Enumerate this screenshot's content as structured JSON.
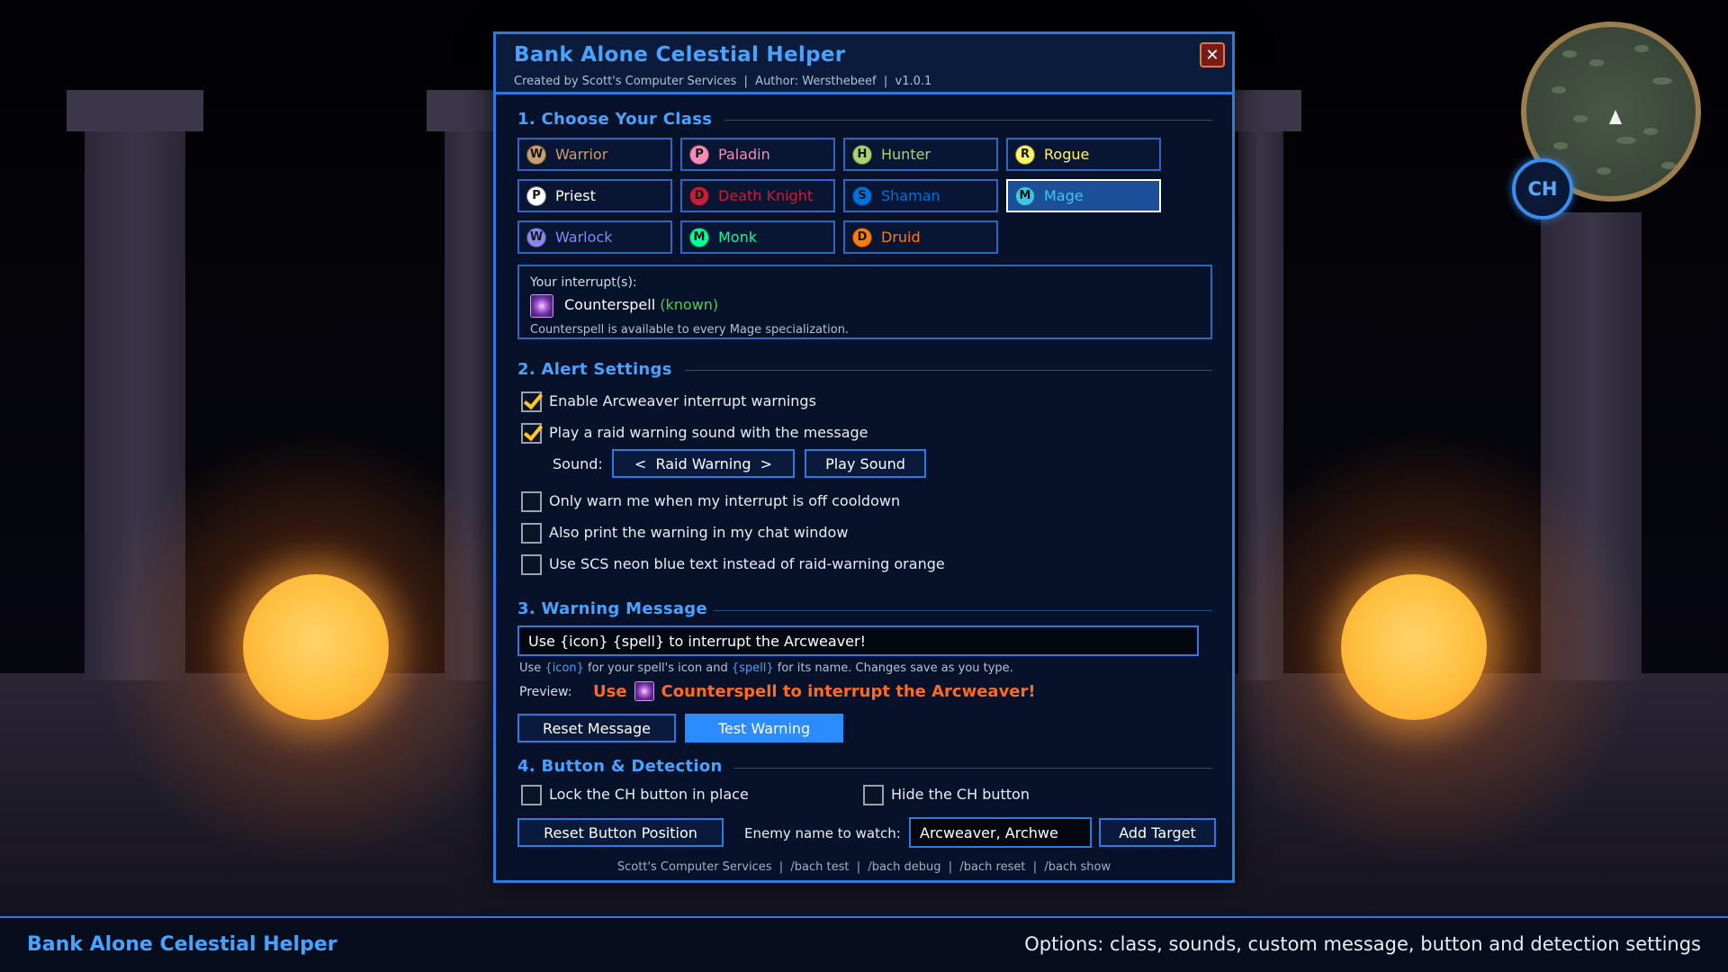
{
  "dialog": {
    "title": "Bank Alone Celestial Helper",
    "subtitle": "Created by Scott's Computer Services  |  Author: Wersthebeef  |  v1.0.1",
    "close_label": "✕"
  },
  "sections": {
    "class": "1.  Choose Your Class",
    "alert": "2.  Alert Settings",
    "message": "3.  Warning Message",
    "button": "4.  Button & Detection"
  },
  "classes": [
    {
      "letter": "W",
      "name": "Warrior",
      "color": "#c8a070",
      "selected": false
    },
    {
      "letter": "P",
      "name": "Paladin",
      "color": "#f48cba",
      "selected": false
    },
    {
      "letter": "H",
      "name": "Hunter",
      "color": "#aad372",
      "selected": false
    },
    {
      "letter": "R",
      "name": "Rogue",
      "color": "#fff468",
      "selected": false
    },
    {
      "letter": "P",
      "name": "Priest",
      "color": "#ffffff",
      "selected": false
    },
    {
      "letter": "D",
      "name": "Death Knight",
      "color": "#c41e3a",
      "selected": false
    },
    {
      "letter": "S",
      "name": "Shaman",
      "color": "#0070dd",
      "selected": false
    },
    {
      "letter": "M",
      "name": "Mage",
      "color": "#3fc7eb",
      "selected": true
    },
    {
      "letter": "W",
      "name": "Warlock",
      "color": "#8788ee",
      "selected": false
    },
    {
      "letter": "M",
      "name": "Monk",
      "color": "#00ff98",
      "selected": false
    },
    {
      "letter": "D",
      "name": "Druid",
      "color": "#ff7c0a",
      "selected": false
    }
  ],
  "interrupt": {
    "label": "Your interrupt(s):",
    "spell": "Counterspell",
    "status": "(known)",
    "note": "Counterspell is available to every Mage specialization."
  },
  "alert": {
    "enable_label": "Enable Arcweaver interrupt warnings",
    "enable_checked": true,
    "sound_label": "Play a raid warning sound with the message",
    "sound_checked": true,
    "sound_prefix": "Sound:",
    "sound_value": "<  Raid Warning  >",
    "play_sound": "Play Sound",
    "cooldown_label": "Only warn me when my interrupt is off cooldown",
    "cooldown_checked": false,
    "chat_label": "Also print the warning in my chat window",
    "chat_checked": false,
    "neon_label": "Use SCS neon blue text instead of raid-warning orange",
    "neon_checked": false
  },
  "message": {
    "value": "Use {icon} {spell} to interrupt the Arcweaver!",
    "hint_use": "Use ",
    "hint_icon": "{icon}",
    "hint_mid": " for your spell's icon and ",
    "hint_spell": "{spell}",
    "hint_end": " for its name. Changes save as you type.",
    "preview_label": "Preview:",
    "preview_pre": "Use",
    "preview_post": "Counterspell to interrupt the Arcweaver!",
    "reset": "Reset Message",
    "test": "Test Warning"
  },
  "button_detection": {
    "lock_label": "Lock the CH button in place",
    "lock_checked": false,
    "hide_label": "Hide the CH button",
    "hide_checked": false,
    "reset_position": "Reset Button Position",
    "enemy_label": "Enemy name to watch:",
    "enemy_value": "Arcweaver, Archwe",
    "add_target": "Add Target"
  },
  "footer": "Scott's Computer Services  |  /bach test  |  /bach debug  |  /bach reset  |  /bach show",
  "minimap": {
    "badge": "CH"
  },
  "statusbar": {
    "title": "Bank Alone Celestial Helper",
    "description": "Options: class, sounds, custom message, button and detection settings"
  },
  "colors": {
    "accent": "#2f7ae0",
    "title": "#4aa2ff",
    "warning": "#ff6a1e",
    "known": "#48d04a"
  }
}
